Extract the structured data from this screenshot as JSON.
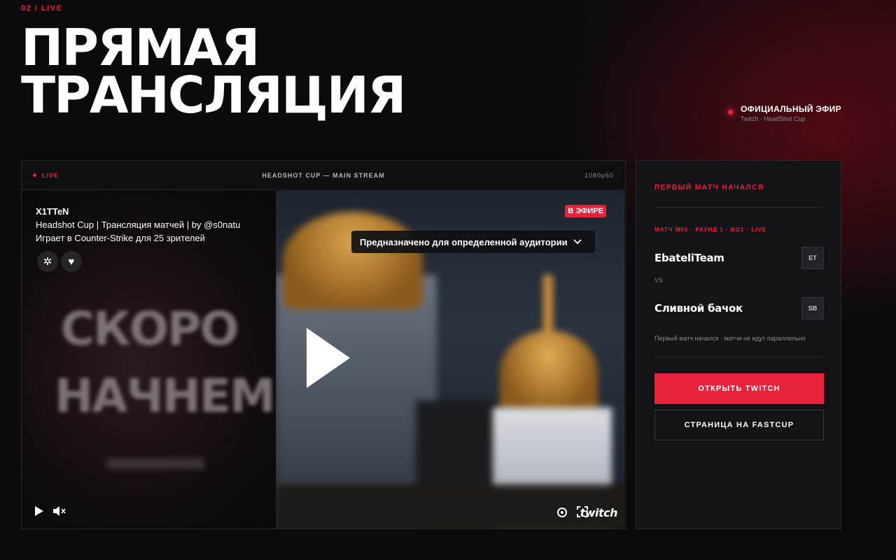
{
  "section": {
    "tag": "02 / LIVE"
  },
  "hero": {
    "line1": "ПРЯМАЯ",
    "line2": "ТРАНСЛЯЦИЯ"
  },
  "official": {
    "title": "ОФИЦИАЛЬНЫЙ ЭФИР",
    "subtitle": "Twitch · HeadShot Cup"
  },
  "player": {
    "live_label": "LIVE",
    "stream_title": "HEADSHOT CUP — MAIN STREAM",
    "resolution": "1080p60",
    "channel_name": "X1TTeN",
    "stream_desc": "Headshot Cup | Трансляция матчей | by @s0natu",
    "viewers_line": "Играет в Counter-Strike для 25 зрителей",
    "on_air_badge": "В ЭФИРЕ",
    "audience_label": "Предназначено для определенной аудитории",
    "preview_text_1": "СКОРО",
    "preview_text_2": "НАЧНЕМ",
    "brand": "twitch",
    "icons": {
      "play_small": "play-icon",
      "mute": "mute-icon",
      "settings": "gear-icon",
      "fullscreen": "fullscreen-icon",
      "chevron": "chevron-down-icon",
      "heart": "heart-icon",
      "avatar": "channel-avatar"
    }
  },
  "match_card": {
    "header": "ПЕРВЫЙ МАТЧ НАЧАЛСЯ",
    "round": "МАТЧ M01 · РАУНД 1 · BO1 · LIVE",
    "team1": {
      "name": "EbateliTeam",
      "abbr": "ET"
    },
    "vs": "VS",
    "team2": {
      "name": "Сливной бачок",
      "abbr": "SB"
    },
    "note": "Первый матч начался · матчи не идут параллельно",
    "primary_button": "ОТКРЫТЬ TWITCH",
    "secondary_button": "СТРАНИЦА НА FASTCUP"
  },
  "colors": {
    "accent": "#e8223a",
    "background": "#0b0b0d",
    "card": "#141418"
  }
}
